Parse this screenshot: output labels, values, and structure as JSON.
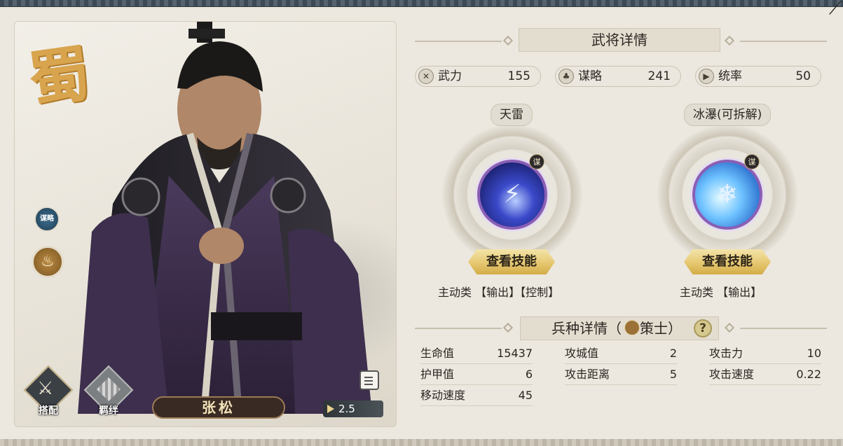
{
  "header": {
    "title": "武将详情"
  },
  "close_glyph": "⟋",
  "general": {
    "faction_glyph": "蜀",
    "name": "张松",
    "level": "2.5",
    "strategy_badge": "谋略",
    "class_icon_glyph": "♨"
  },
  "actions": {
    "equip_label": "搭配",
    "bond_label": "羁绊"
  },
  "stats": [
    {
      "name": "武力",
      "value": "155",
      "icon": "swords-icon"
    },
    {
      "name": "谋略",
      "value": "241",
      "icon": "leaf-icon"
    },
    {
      "name": "统率",
      "value": "50",
      "icon": "banner-icon"
    }
  ],
  "skills": [
    {
      "name": "天雷",
      "tag": "谋",
      "button": "查看技能",
      "type": "主动类 【输出】【控制】",
      "icon": "lightning-orb-icon"
    },
    {
      "name": "冰瀑(可拆解)",
      "tag": "谋",
      "button": "查看技能",
      "type": "主动类 【输出】",
      "icon": "snowflake-orb-icon"
    }
  ],
  "troop": {
    "title_prefix": "兵种详情（",
    "class_name": "策士",
    "title_suffix": "）",
    "help": "?",
    "rows": [
      [
        {
          "k": "生命值",
          "v": "15437"
        },
        {
          "k": "攻城值",
          "v": "2"
        },
        {
          "k": "攻击力",
          "v": "10"
        }
      ],
      [
        {
          "k": "护甲值",
          "v": "6"
        },
        {
          "k": "攻击距离",
          "v": "5"
        },
        {
          "k": "攻击速度",
          "v": "0.22"
        }
      ],
      [
        {
          "k": "移动速度",
          "v": "45"
        }
      ]
    ]
  },
  "colors": {
    "accent_gold": "#e4c56c",
    "name_plate": "#3a2a24",
    "faction_gold": "#d8a44d"
  }
}
